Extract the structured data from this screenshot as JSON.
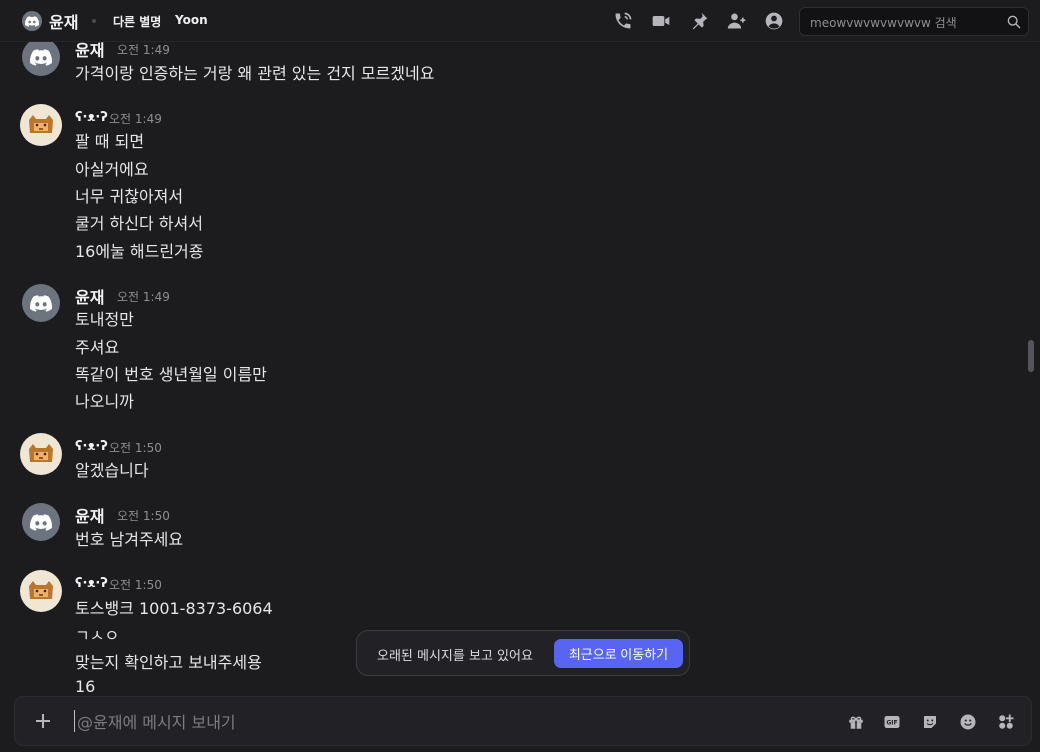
{
  "header": {
    "title": "윤재",
    "alias_label": "다른 별명",
    "alias_value": "Yoon",
    "search_placeholder": "meowvwvwvwvwvw 검색"
  },
  "messages": [
    {
      "author": "윤재",
      "avatar": "discord",
      "time": "오전 1:49",
      "lines": [
        "가격이랑 인증하는 거랑 왜 관련 있는 건지 모르겠네요"
      ]
    },
    {
      "author": "ʕ·ᴥ·ʔ",
      "avatar": "cat",
      "time": "오전 1:49",
      "lines": [
        "팔 때 되면",
        "아실거에요",
        "너무 귀찮아져서",
        "쿨거 하신다 하셔서",
        "16에눌 해드린거죵"
      ]
    },
    {
      "author": "윤재",
      "avatar": "discord",
      "time": "오전 1:49",
      "lines": [
        "토내정만",
        "주셔요",
        "똑같이 번호 생년월일 이름만",
        "나오니까"
      ]
    },
    {
      "author": "ʕ·ᴥ·ʔ",
      "avatar": "cat",
      "time": "오전 1:50",
      "lines": [
        "알겠습니다"
      ]
    },
    {
      "author": "윤재",
      "avatar": "discord",
      "time": "오전 1:50",
      "lines": [
        "번호 남겨주세요"
      ]
    },
    {
      "author": "ʕ·ᴥ·ʔ",
      "avatar": "cat",
      "time": "오전 1:50",
      "lines": [
        "토스뱅크 1001-8373-6064",
        "ㄱㅅㅇ",
        "맞는지 확인하고 보내주세용",
        "16"
      ]
    }
  ],
  "banner": {
    "text": "오래된 메시지를 보고 있어요",
    "button": "최근으로 이동하기"
  },
  "composer": {
    "placeholder": "@윤재에 메시지 보내기"
  },
  "colors": {
    "background": "#1c1c1f",
    "accent": "#5865f2",
    "discord_avatar": "#6c7480"
  },
  "icons": {
    "header": [
      "phone-call-icon",
      "video-call-icon",
      "pin-icon",
      "add-friend-icon",
      "user-profile-icon"
    ],
    "composer": [
      "gift-icon",
      "gif-icon",
      "sticker-icon",
      "emoji-icon",
      "apps-icon"
    ]
  }
}
